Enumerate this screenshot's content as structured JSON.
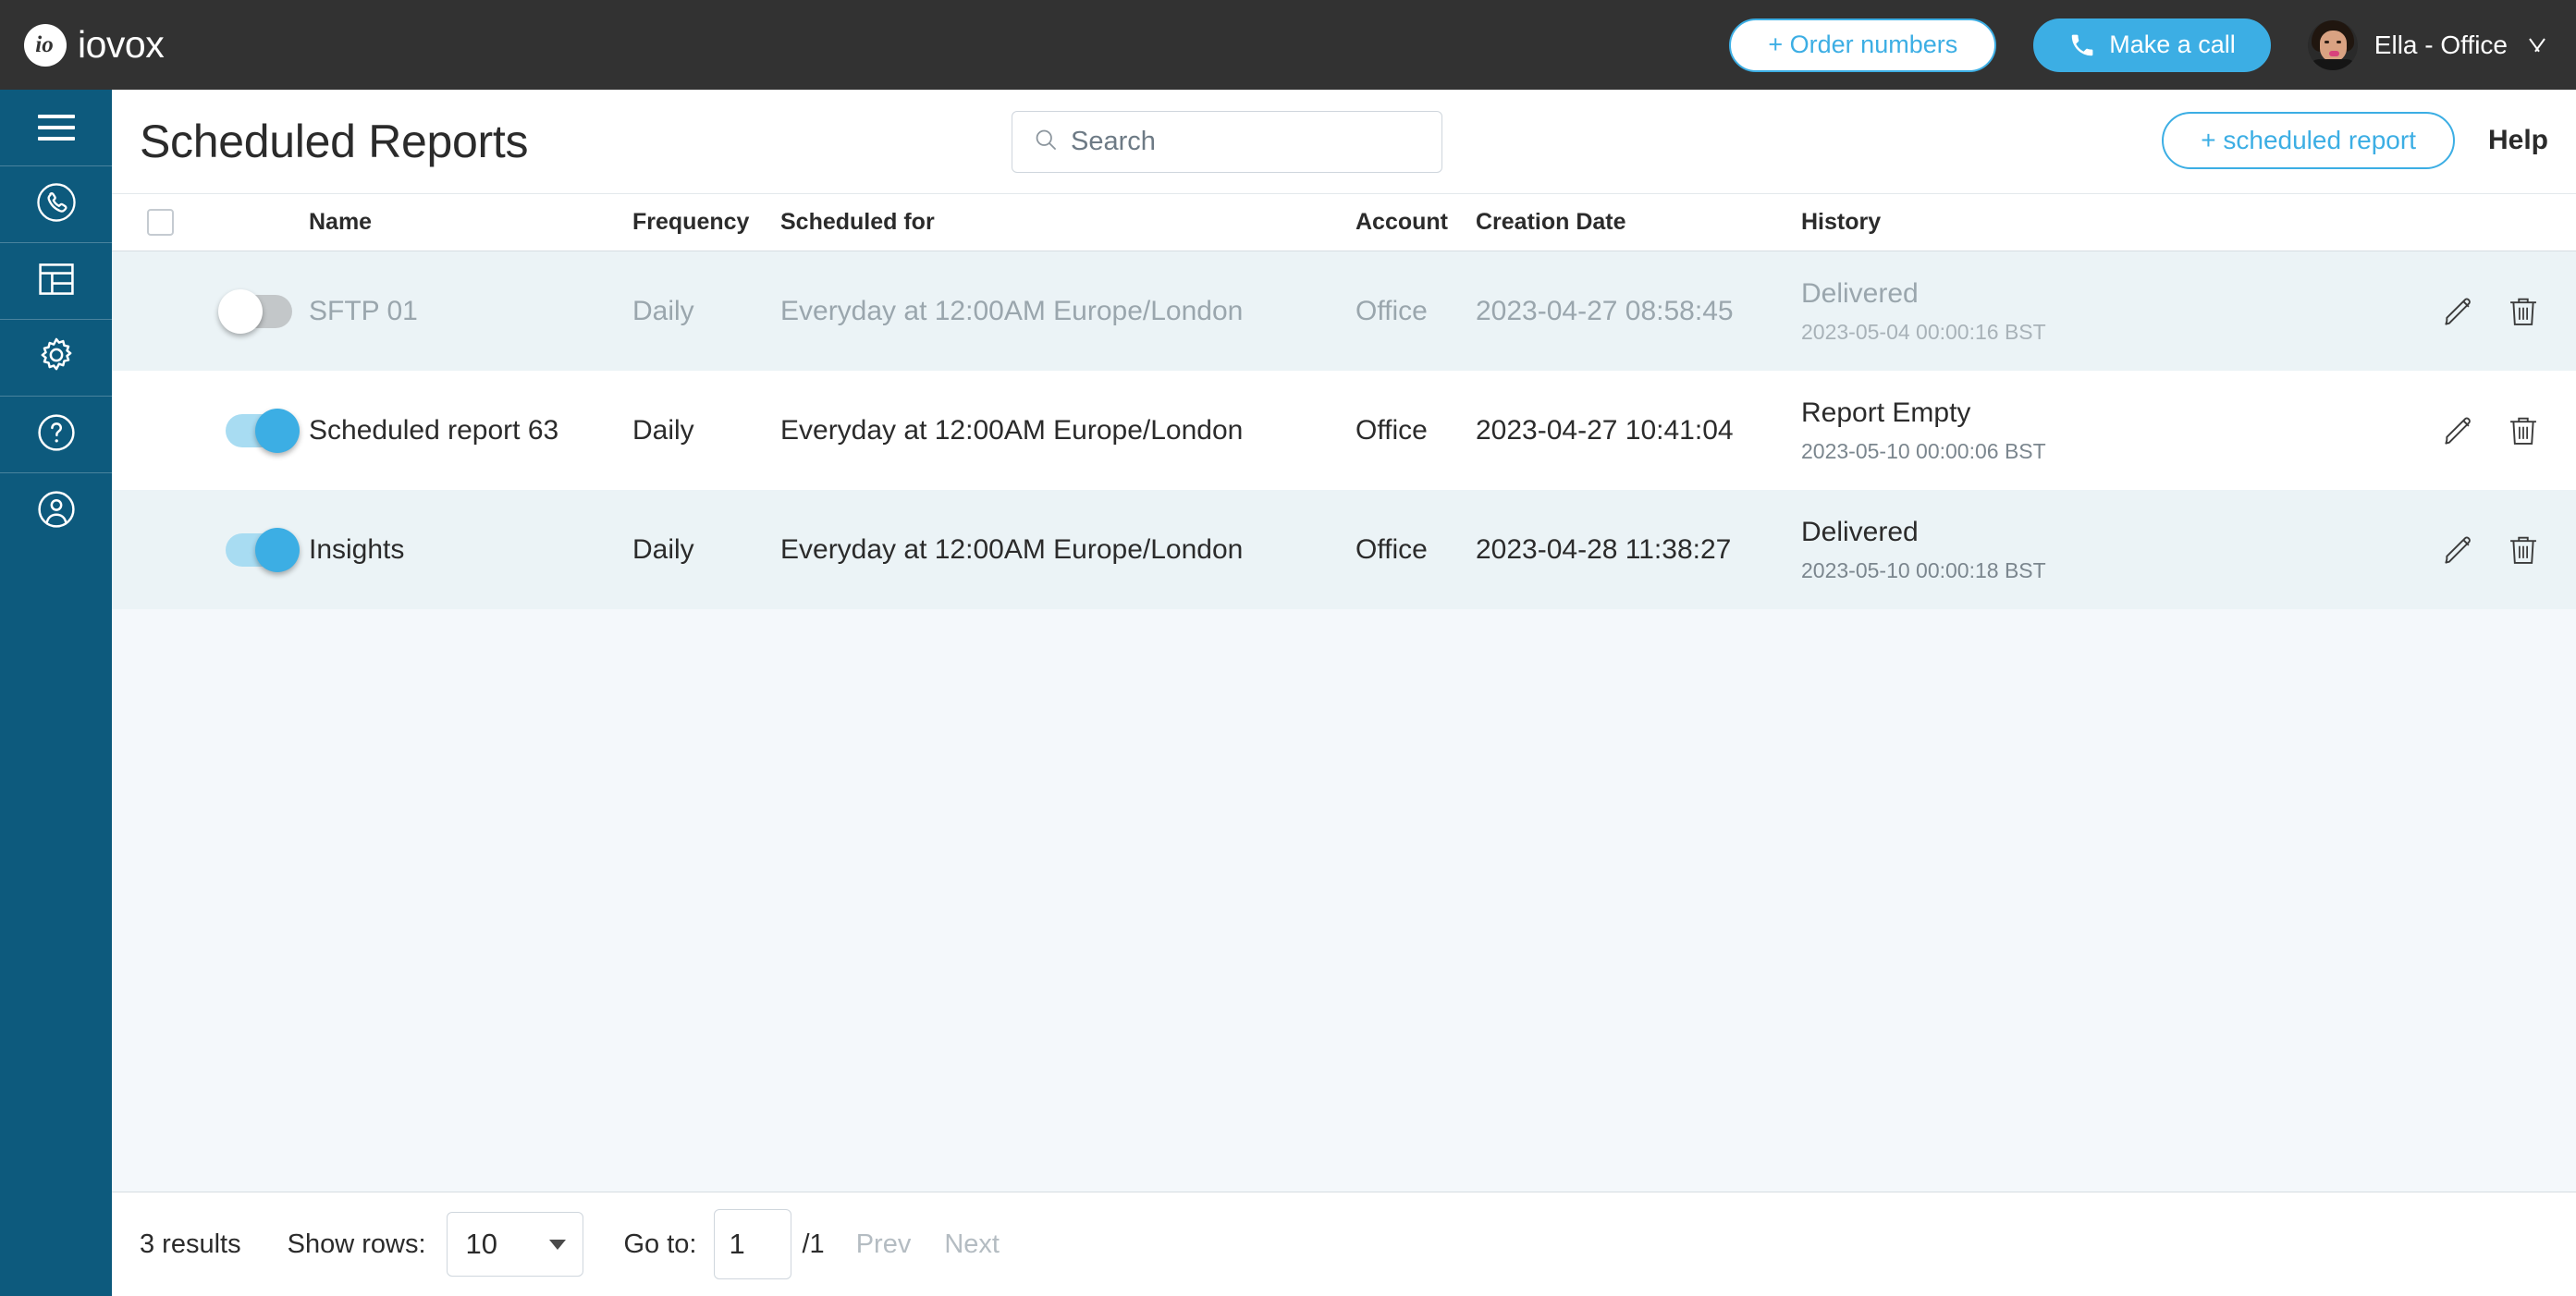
{
  "topbar": {
    "logo_mark": "io",
    "logo_text": "iovox",
    "order_numbers_label": "+ Order numbers",
    "make_call_label": "Make a call",
    "user_name": "Ella - Office"
  },
  "sidebar": {
    "items": [
      {
        "icon": "hamburger-menu-icon",
        "name": "menu"
      },
      {
        "icon": "phone-circle-icon",
        "name": "calls"
      },
      {
        "icon": "dashboard-layout-icon",
        "name": "reports"
      },
      {
        "icon": "gear-icon",
        "name": "settings"
      },
      {
        "icon": "question-circle-icon",
        "name": "help"
      },
      {
        "icon": "user-circle-icon",
        "name": "account"
      }
    ]
  },
  "header": {
    "title": "Scheduled Reports",
    "search_placeholder": "Search",
    "add_report_label": "+ scheduled report",
    "help_label": "Help"
  },
  "table": {
    "columns": {
      "name": "Name",
      "frequency": "Frequency",
      "scheduled_for": "Scheduled for",
      "account": "Account",
      "creation_date": "Creation Date",
      "history": "History"
    },
    "rows": [
      {
        "enabled": false,
        "name": "SFTP 01",
        "frequency": "Daily",
        "scheduled_for": "Everyday at 12:00AM Europe/London",
        "account": "Office",
        "creation_date": "2023-04-27 08:58:45",
        "history_status": "Delivered",
        "history_time": "2023-05-04 00:00:16 BST"
      },
      {
        "enabled": true,
        "name": "Scheduled report 63",
        "frequency": "Daily",
        "scheduled_for": "Everyday at 12:00AM Europe/London",
        "account": "Office",
        "creation_date": "2023-04-27 10:41:04",
        "history_status": "Report Empty",
        "history_time": "2023-05-10 00:00:06 BST"
      },
      {
        "enabled": true,
        "name": "Insights",
        "frequency": "Daily",
        "scheduled_for": "Everyday at 12:00AM Europe/London",
        "account": "Office",
        "creation_date": "2023-04-28 11:38:27",
        "history_status": "Delivered",
        "history_time": "2023-05-10 00:00:18 BST"
      }
    ]
  },
  "pagination": {
    "results": "3 results",
    "show_rows_label": "Show rows:",
    "rows_value": "10",
    "goto_label": "Go to:",
    "goto_value": "1",
    "total_pages": "/1",
    "prev_label": "Prev",
    "next_label": "Next"
  },
  "colors": {
    "brand_blue": "#3caee4",
    "sidebar_blue": "#0d5a7d",
    "topbar_dark": "#323232",
    "row_shade": "#ebf3f6",
    "page_bg": "#f4f8fb"
  }
}
